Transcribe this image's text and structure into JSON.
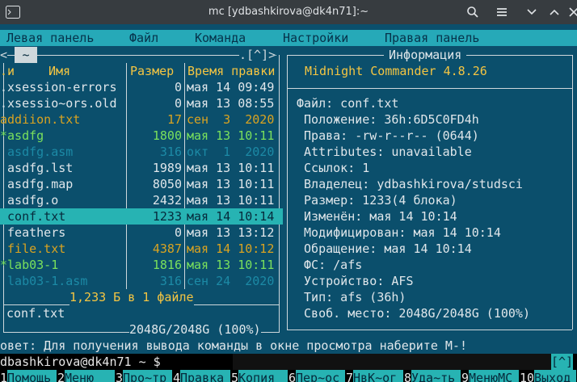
{
  "window": {
    "title": "mc [ydbashkirova@dk4n71]:~"
  },
  "menubar": [
    "Левая панель",
    "Файл",
    "Команда",
    "Настройки",
    "Правая панель"
  ],
  "left_panel": {
    "path": "~",
    "top_right_marker": ".[^]>",
    "top_left_marker": "<",
    "col_headers": {
      "name_prefix": ".и",
      "name": "Имя",
      "size": "Размер",
      "time": "Время правки"
    },
    "files": [
      {
        "name": ".xsession-errors",
        "size": "0",
        "time": "мая 14 09:49",
        "style": "white"
      },
      {
        "name": ".xsessio~ors.old",
        "size": "0",
        "time": "мая 13 08:55",
        "style": "white"
      },
      {
        "name": "addiion.txt",
        "size": "17",
        "time": "сен  3  2020",
        "style": "yellow"
      },
      {
        "name": "*asdfg",
        "size": "1800",
        "time": "мая 13 10:11",
        "style": "green"
      },
      {
        "name": " asdfg.asm",
        "size": "316",
        "time": "окт  1  2020",
        "style": "dimcyan"
      },
      {
        "name": " asdfg.lst",
        "size": "1989",
        "time": "мая 13 10:11",
        "style": "white"
      },
      {
        "name": " asdfg.map",
        "size": "8050",
        "time": "мая 13 10:11",
        "style": "white"
      },
      {
        "name": " asdfg.o",
        "size": "2432",
        "time": "мая 13 10:11",
        "style": "white"
      },
      {
        "name": " conf.txt",
        "size": "1233",
        "time": "мая 14 10:14",
        "style": "selected"
      },
      {
        "name": " feathers",
        "size": "0",
        "time": "мая 13 13:12",
        "style": "white"
      },
      {
        "name": " file.txt",
        "size": "4387",
        "time": "мая 14 10:12",
        "style": "yellow"
      },
      {
        "name": "*lab03-1",
        "size": "1816",
        "time": "мая 13 10:11",
        "style": "green"
      },
      {
        "name": " lab03-1.asm",
        "size": "316",
        "time": "сен 24  2020",
        "style": "dimcyan"
      }
    ],
    "summary": "1,233 Б в 1 файле",
    "mini_status": "conf.txt",
    "free_space": "2048G/2048G (100%)"
  },
  "info_panel": {
    "title": "Информация",
    "app": "Midnight Commander 4.8.26",
    "lines": [
      "Файл: conf.txt",
      " Положение: 36h:6D5C0FD4h",
      " Права: -rw-r--r-- (0644)",
      " Attributes: unavailable",
      " Ссылок: 1",
      " Владелец: ydbashkirova/studsci",
      " Размер: 1233(4 блока)",
      " Изменён: мая 14 10:14",
      " Модифицирован: мая 14 10:14",
      " Обращение: мая 14 10:14",
      " ФС: /afs",
      " Устройство: AFS",
      " Тип: afs (36h)",
      " Своб. место: 2048G/2048G (100%)"
    ]
  },
  "hint": "овет: Для получения вывода команды в окне просмотра наберите M-!",
  "prompt": "dbashkirova@dk4n71 ~ $",
  "prompt_marker": "[^]",
  "fkeys": [
    {
      "num": "1",
      "label": "Помощь"
    },
    {
      "num": "2",
      "label": "Меню"
    },
    {
      "num": "3",
      "label": "Про~тр"
    },
    {
      "num": "4",
      "label": "Правка"
    },
    {
      "num": "5",
      "label": "Копия"
    },
    {
      "num": "6",
      "label": "Пер~ос"
    },
    {
      "num": "7",
      "label": "НвК~ог"
    },
    {
      "num": "8",
      "label": "Уда~ть"
    },
    {
      "num": "9",
      "label": "МенюМС"
    },
    {
      "num": "10",
      "label": "Выход"
    }
  ],
  "colors": {
    "background": "#0b4f6c",
    "accent": "#27b3b3",
    "header": "#f4c542",
    "executable": "#7ae05c",
    "document": "#d9a321"
  }
}
